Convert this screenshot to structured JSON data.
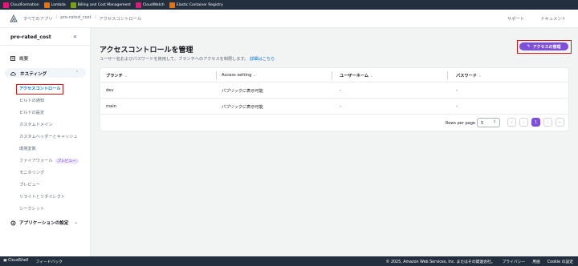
{
  "favorites": [
    {
      "label": "CloudFormation",
      "color": "#e7157b",
      "icon": "cloudformation-icon"
    },
    {
      "label": "Lambda",
      "color": "#ed7100",
      "icon": "lambda-icon"
    },
    {
      "label": "Billing and Cost Management",
      "color": "#7aa116",
      "icon": "billing-icon"
    },
    {
      "label": "CloudWatch",
      "color": "#e7157b",
      "icon": "cloudwatch-icon"
    },
    {
      "label": "Elastic Container Registry",
      "color": "#ed7100",
      "icon": "ecr-icon"
    }
  ],
  "header": {
    "breadcrumbs": [
      "すべてのアプリ",
      "pro-rated_cost",
      "アクセスコントロール"
    ],
    "support": "サポート",
    "docs": "ドキュメント"
  },
  "sidebar": {
    "app_name": "pro-rated_cost",
    "overview": "概要",
    "hosting": "ホスティング",
    "items": [
      "アクセスコントロール",
      "ビルドの通知",
      "ビルドの設定",
      "カスタムドメイン",
      "カスタムヘッダーとキャッシュ",
      "環境変数",
      "ファイアウォール",
      "モニタリング",
      "プレビュー",
      "リライトとリダイレクト",
      "シークレット"
    ],
    "badge": "プレビュー",
    "app_settings": "アプリケーションの設定"
  },
  "main": {
    "title": "アクセスコントロールを管理",
    "description": "ユーザー名およびパスワードを使用して、ブランチへのアクセスを制限します。",
    "learn_more": "詳細はこちら",
    "manage_button": "アクセスの管理"
  },
  "table": {
    "columns": [
      "ブランチ",
      "Access setting",
      "ユーザーネーム",
      "パスワード"
    ],
    "rows": [
      [
        "dev",
        "パブリックに表示可能",
        "-",
        "-"
      ],
      [
        "main",
        "パブリックに表示可能",
        "-",
        "-"
      ]
    ]
  },
  "pagination": {
    "rows_per_page_label": "Rows per page",
    "rows_per_page": "5",
    "current_page": "1"
  },
  "footer": {
    "cloudshell": "CloudShell",
    "feedback": "フィードバック",
    "copyright": "© 2025, Amazon Web Services, Inc. またはその関連会社。",
    "privacy": "プライバシー",
    "terms": "用語",
    "cookies": "Cookie の設定"
  }
}
